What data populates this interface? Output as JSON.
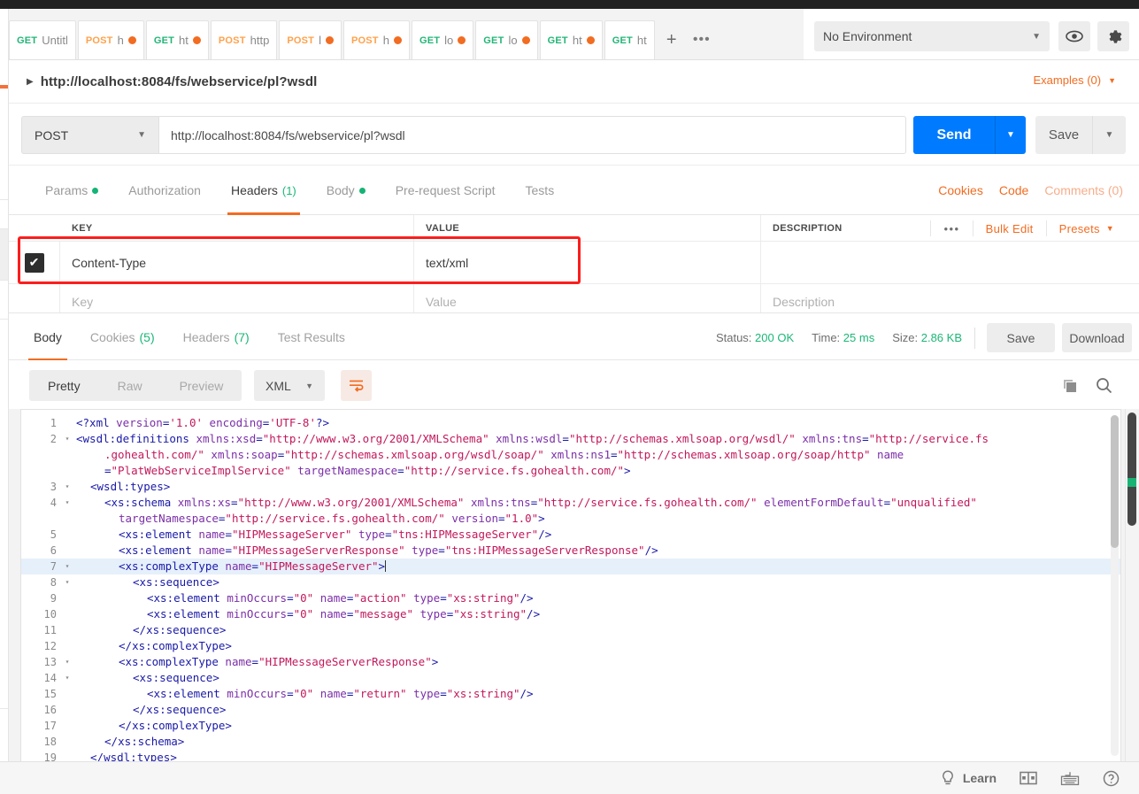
{
  "tabbar": {
    "tabs": [
      {
        "method": "GET",
        "name": "Untitl",
        "dirty": false
      },
      {
        "method": "POST",
        "name": "h",
        "dirty": true
      },
      {
        "method": "GET",
        "name": "ht",
        "dirty": true
      },
      {
        "method": "POST",
        "name": "http",
        "dirty": false
      },
      {
        "method": "POST",
        "name": "l",
        "dirty": true
      },
      {
        "method": "POST",
        "name": "h",
        "dirty": true
      },
      {
        "method": "GET",
        "name": "lo",
        "dirty": true
      },
      {
        "method": "GET",
        "name": "lo",
        "dirty": true
      },
      {
        "method": "GET",
        "name": "ht",
        "dirty": true
      },
      {
        "method": "GET",
        "name": "ht",
        "dirty": false
      }
    ],
    "add_label": "+",
    "more_label": "•••"
  },
  "environment": {
    "selected": "No Environment",
    "caret": "▼",
    "eye_icon": "eye-icon",
    "gear_icon": "gear-icon"
  },
  "request": {
    "title": "http://localhost:8084/fs/webservice/pl?wsdl",
    "examples_label": "Examples (0)",
    "method": "POST",
    "url": "http://localhost:8084/fs/webservice/pl?wsdl",
    "send_label": "Send",
    "save_label": "Save",
    "tabs": [
      {
        "label": "Params",
        "dot": true,
        "count": "",
        "active": false
      },
      {
        "label": "Authorization",
        "dot": false,
        "count": "",
        "active": false
      },
      {
        "label": "Headers",
        "dot": false,
        "count": "(1)",
        "active": true
      },
      {
        "label": "Body",
        "dot": true,
        "count": "",
        "active": false
      },
      {
        "label": "Pre-request Script",
        "dot": false,
        "count": "",
        "active": false
      },
      {
        "label": "Tests",
        "dot": false,
        "count": "",
        "active": false
      }
    ],
    "right_links": [
      {
        "label": "Cookies",
        "muted": false
      },
      {
        "label": "Code",
        "muted": false
      },
      {
        "label": "Comments (0)",
        "muted": true
      }
    ]
  },
  "headers_table": {
    "columns": {
      "key": "KEY",
      "value": "VALUE",
      "description": "DESCRIPTION"
    },
    "actions": {
      "dots": "•••",
      "bulk_edit": "Bulk Edit",
      "presets": "Presets",
      "presets_caret": "▼"
    },
    "rows": [
      {
        "checked": true,
        "key": "Content-Type",
        "value": "text/xml",
        "description": ""
      }
    ],
    "placeholder_row": {
      "key": "Key",
      "value": "Value",
      "description": "Description"
    },
    "highlight_color": "#fc1d1d"
  },
  "response": {
    "tabs": [
      {
        "label": "Body",
        "count": "",
        "active": true
      },
      {
        "label": "Cookies",
        "count": "(5)",
        "active": false
      },
      {
        "label": "Headers",
        "count": "(7)",
        "active": false
      },
      {
        "label": "Test Results",
        "count": "",
        "active": false
      }
    ],
    "status_label": "Status:",
    "status_value": "200 OK",
    "time_label": "Time:",
    "time_value": "25 ms",
    "size_label": "Size:",
    "size_value": "2.86 KB",
    "save_label": "Save",
    "download_label": "Download",
    "view_modes": [
      {
        "label": "Pretty",
        "active": true
      },
      {
        "label": "Raw",
        "active": false
      },
      {
        "label": "Preview",
        "active": false
      }
    ],
    "format": "XML",
    "format_caret": "▼",
    "wrap_icon": "word-wrap-icon",
    "copy_icon": "copy-icon",
    "search_icon": "search-icon"
  },
  "code": {
    "lines": [
      {
        "n": "1",
        "fold": "",
        "hl": false,
        "indent": 0,
        "parts": [
          {
            "t": "pun",
            "v": "<?xml "
          },
          {
            "t": "at",
            "v": "version"
          },
          {
            "t": "pun",
            "v": "="
          },
          {
            "t": "st",
            "v": "'1.0'"
          },
          {
            "t": "pun",
            "v": " "
          },
          {
            "t": "at",
            "v": "encoding"
          },
          {
            "t": "pun",
            "v": "="
          },
          {
            "t": "st",
            "v": "'UTF-8'"
          },
          {
            "t": "pun",
            "v": "?>"
          }
        ]
      },
      {
        "n": "2",
        "fold": "▾",
        "hl": false,
        "indent": 0,
        "parts": [
          {
            "t": "pun",
            "v": "<"
          },
          {
            "t": "tg",
            "v": "wsdl:definitions"
          },
          {
            "t": "pun",
            "v": " "
          },
          {
            "t": "at",
            "v": "xmlns:xsd"
          },
          {
            "t": "pun",
            "v": "="
          },
          {
            "t": "st",
            "v": "\"http://www.w3.org/2001/XMLSchema\""
          },
          {
            "t": "pun",
            "v": " "
          },
          {
            "t": "at",
            "v": "xmlns:wsdl"
          },
          {
            "t": "pun",
            "v": "="
          },
          {
            "t": "st",
            "v": "\"http://schemas.xmlsoap.org/wsdl/\""
          },
          {
            "t": "pun",
            "v": " "
          },
          {
            "t": "at",
            "v": "xmlns:tns"
          },
          {
            "t": "pun",
            "v": "="
          },
          {
            "t": "st",
            "v": "\"http://service.fs"
          }
        ]
      },
      {
        "n": "",
        "fold": "",
        "hl": false,
        "indent": 4,
        "parts": [
          {
            "t": "st",
            "v": ".gohealth.com/\""
          },
          {
            "t": "pun",
            "v": " "
          },
          {
            "t": "at",
            "v": "xmlns:soap"
          },
          {
            "t": "pun",
            "v": "="
          },
          {
            "t": "st",
            "v": "\"http://schemas.xmlsoap.org/wsdl/soap/\""
          },
          {
            "t": "pun",
            "v": " "
          },
          {
            "t": "at",
            "v": "xmlns:ns1"
          },
          {
            "t": "pun",
            "v": "="
          },
          {
            "t": "st",
            "v": "\"http://schemas.xmlsoap.org/soap/http\""
          },
          {
            "t": "pun",
            "v": " "
          },
          {
            "t": "at",
            "v": "name"
          }
        ]
      },
      {
        "n": "",
        "fold": "",
        "hl": false,
        "indent": 4,
        "parts": [
          {
            "t": "pun",
            "v": "="
          },
          {
            "t": "st",
            "v": "\"PlatWebServiceImplService\""
          },
          {
            "t": "pun",
            "v": " "
          },
          {
            "t": "at",
            "v": "targetNamespace"
          },
          {
            "t": "pun",
            "v": "="
          },
          {
            "t": "st",
            "v": "\"http://service.fs.gohealth.com/\""
          },
          {
            "t": "pun",
            "v": ">"
          }
        ]
      },
      {
        "n": "3",
        "fold": "▾",
        "hl": false,
        "indent": 2,
        "parts": [
          {
            "t": "pun",
            "v": "<"
          },
          {
            "t": "tg",
            "v": "wsdl:types"
          },
          {
            "t": "pun",
            "v": ">"
          }
        ]
      },
      {
        "n": "4",
        "fold": "▾",
        "hl": false,
        "indent": 4,
        "parts": [
          {
            "t": "pun",
            "v": "<"
          },
          {
            "t": "tg",
            "v": "xs:schema"
          },
          {
            "t": "pun",
            "v": " "
          },
          {
            "t": "at",
            "v": "xmlns:xs"
          },
          {
            "t": "pun",
            "v": "="
          },
          {
            "t": "st",
            "v": "\"http://www.w3.org/2001/XMLSchema\""
          },
          {
            "t": "pun",
            "v": " "
          },
          {
            "t": "at",
            "v": "xmlns:tns"
          },
          {
            "t": "pun",
            "v": "="
          },
          {
            "t": "st",
            "v": "\"http://service.fs.gohealth.com/\""
          },
          {
            "t": "pun",
            "v": " "
          },
          {
            "t": "at",
            "v": "elementFormDefault"
          },
          {
            "t": "pun",
            "v": "="
          },
          {
            "t": "st",
            "v": "\"unqualified\""
          }
        ]
      },
      {
        "n": "",
        "fold": "",
        "hl": false,
        "indent": 6,
        "parts": [
          {
            "t": "at",
            "v": "targetNamespace"
          },
          {
            "t": "pun",
            "v": "="
          },
          {
            "t": "st",
            "v": "\"http://service.fs.gohealth.com/\""
          },
          {
            "t": "pun",
            "v": " "
          },
          {
            "t": "at",
            "v": "version"
          },
          {
            "t": "pun",
            "v": "="
          },
          {
            "t": "st",
            "v": "\"1.0\""
          },
          {
            "t": "pun",
            "v": ">"
          }
        ]
      },
      {
        "n": "5",
        "fold": "",
        "hl": false,
        "indent": 6,
        "parts": [
          {
            "t": "pun",
            "v": "<"
          },
          {
            "t": "tg",
            "v": "xs:element"
          },
          {
            "t": "pun",
            "v": " "
          },
          {
            "t": "at",
            "v": "name"
          },
          {
            "t": "pun",
            "v": "="
          },
          {
            "t": "st",
            "v": "\"HIPMessageServer\""
          },
          {
            "t": "pun",
            "v": " "
          },
          {
            "t": "at",
            "v": "type"
          },
          {
            "t": "pun",
            "v": "="
          },
          {
            "t": "st",
            "v": "\"tns:HIPMessageServer\""
          },
          {
            "t": "pun",
            "v": "/>"
          }
        ]
      },
      {
        "n": "6",
        "fold": "",
        "hl": false,
        "indent": 6,
        "parts": [
          {
            "t": "pun",
            "v": "<"
          },
          {
            "t": "tg",
            "v": "xs:element"
          },
          {
            "t": "pun",
            "v": " "
          },
          {
            "t": "at",
            "v": "name"
          },
          {
            "t": "pun",
            "v": "="
          },
          {
            "t": "st",
            "v": "\"HIPMessageServerResponse\""
          },
          {
            "t": "pun",
            "v": " "
          },
          {
            "t": "at",
            "v": "type"
          },
          {
            "t": "pun",
            "v": "="
          },
          {
            "t": "st",
            "v": "\"tns:HIPMessageServerResponse\""
          },
          {
            "t": "pun",
            "v": "/>"
          }
        ]
      },
      {
        "n": "7",
        "fold": "▾",
        "hl": true,
        "indent": 6,
        "parts": [
          {
            "t": "pun",
            "v": "<"
          },
          {
            "t": "tg",
            "v": "xs:complexType"
          },
          {
            "t": "pun",
            "v": " "
          },
          {
            "t": "at",
            "v": "name"
          },
          {
            "t": "pun",
            "v": "="
          },
          {
            "t": "st",
            "v": "\"HIPMessageServer\""
          },
          {
            "t": "pun",
            "v": ">"
          },
          {
            "t": "cursor",
            "v": ""
          }
        ]
      },
      {
        "n": "8",
        "fold": "▾",
        "hl": false,
        "indent": 8,
        "parts": [
          {
            "t": "pun",
            "v": "<"
          },
          {
            "t": "tg",
            "v": "xs:sequence"
          },
          {
            "t": "pun",
            "v": ">"
          }
        ]
      },
      {
        "n": "9",
        "fold": "",
        "hl": false,
        "indent": 10,
        "parts": [
          {
            "t": "pun",
            "v": "<"
          },
          {
            "t": "tg",
            "v": "xs:element"
          },
          {
            "t": "pun",
            "v": " "
          },
          {
            "t": "at",
            "v": "minOccurs"
          },
          {
            "t": "pun",
            "v": "="
          },
          {
            "t": "st",
            "v": "\"0\""
          },
          {
            "t": "pun",
            "v": " "
          },
          {
            "t": "at",
            "v": "name"
          },
          {
            "t": "pun",
            "v": "="
          },
          {
            "t": "st",
            "v": "\"action\""
          },
          {
            "t": "pun",
            "v": " "
          },
          {
            "t": "at",
            "v": "type"
          },
          {
            "t": "pun",
            "v": "="
          },
          {
            "t": "st",
            "v": "\"xs:string\""
          },
          {
            "t": "pun",
            "v": "/>"
          }
        ]
      },
      {
        "n": "10",
        "fold": "",
        "hl": false,
        "indent": 10,
        "parts": [
          {
            "t": "pun",
            "v": "<"
          },
          {
            "t": "tg",
            "v": "xs:element"
          },
          {
            "t": "pun",
            "v": " "
          },
          {
            "t": "at",
            "v": "minOccurs"
          },
          {
            "t": "pun",
            "v": "="
          },
          {
            "t": "st",
            "v": "\"0\""
          },
          {
            "t": "pun",
            "v": " "
          },
          {
            "t": "at",
            "v": "name"
          },
          {
            "t": "pun",
            "v": "="
          },
          {
            "t": "st",
            "v": "\"message\""
          },
          {
            "t": "pun",
            "v": " "
          },
          {
            "t": "at",
            "v": "type"
          },
          {
            "t": "pun",
            "v": "="
          },
          {
            "t": "st",
            "v": "\"xs:string\""
          },
          {
            "t": "pun",
            "v": "/>"
          }
        ]
      },
      {
        "n": "11",
        "fold": "",
        "hl": false,
        "indent": 8,
        "parts": [
          {
            "t": "pun",
            "v": "</"
          },
          {
            "t": "tg",
            "v": "xs:sequence"
          },
          {
            "t": "pun",
            "v": ">"
          }
        ]
      },
      {
        "n": "12",
        "fold": "",
        "hl": false,
        "indent": 6,
        "parts": [
          {
            "t": "pun",
            "v": "</"
          },
          {
            "t": "tg",
            "v": "xs:complexType"
          },
          {
            "t": "pun",
            "v": ">"
          }
        ]
      },
      {
        "n": "13",
        "fold": "▾",
        "hl": false,
        "indent": 6,
        "parts": [
          {
            "t": "pun",
            "v": "<"
          },
          {
            "t": "tg",
            "v": "xs:complexType"
          },
          {
            "t": "pun",
            "v": " "
          },
          {
            "t": "at",
            "v": "name"
          },
          {
            "t": "pun",
            "v": "="
          },
          {
            "t": "st",
            "v": "\"HIPMessageServerResponse\""
          },
          {
            "t": "pun",
            "v": ">"
          }
        ]
      },
      {
        "n": "14",
        "fold": "▾",
        "hl": false,
        "indent": 8,
        "parts": [
          {
            "t": "pun",
            "v": "<"
          },
          {
            "t": "tg",
            "v": "xs:sequence"
          },
          {
            "t": "pun",
            "v": ">"
          }
        ]
      },
      {
        "n": "15",
        "fold": "",
        "hl": false,
        "indent": 10,
        "parts": [
          {
            "t": "pun",
            "v": "<"
          },
          {
            "t": "tg",
            "v": "xs:element"
          },
          {
            "t": "pun",
            "v": " "
          },
          {
            "t": "at",
            "v": "minOccurs"
          },
          {
            "t": "pun",
            "v": "="
          },
          {
            "t": "st",
            "v": "\"0\""
          },
          {
            "t": "pun",
            "v": " "
          },
          {
            "t": "at",
            "v": "name"
          },
          {
            "t": "pun",
            "v": "="
          },
          {
            "t": "st",
            "v": "\"return\""
          },
          {
            "t": "pun",
            "v": " "
          },
          {
            "t": "at",
            "v": "type"
          },
          {
            "t": "pun",
            "v": "="
          },
          {
            "t": "st",
            "v": "\"xs:string\""
          },
          {
            "t": "pun",
            "v": "/>"
          }
        ]
      },
      {
        "n": "16",
        "fold": "",
        "hl": false,
        "indent": 8,
        "parts": [
          {
            "t": "pun",
            "v": "</"
          },
          {
            "t": "tg",
            "v": "xs:sequence"
          },
          {
            "t": "pun",
            "v": ">"
          }
        ]
      },
      {
        "n": "17",
        "fold": "",
        "hl": false,
        "indent": 6,
        "parts": [
          {
            "t": "pun",
            "v": "</"
          },
          {
            "t": "tg",
            "v": "xs:complexType"
          },
          {
            "t": "pun",
            "v": ">"
          }
        ]
      },
      {
        "n": "18",
        "fold": "",
        "hl": false,
        "indent": 4,
        "parts": [
          {
            "t": "pun",
            "v": "</"
          },
          {
            "t": "tg",
            "v": "xs:schema"
          },
          {
            "t": "pun",
            "v": ">"
          }
        ]
      },
      {
        "n": "19",
        "fold": "",
        "hl": false,
        "indent": 2,
        "parts": [
          {
            "t": "pun",
            "v": "</"
          },
          {
            "t": "tg",
            "v": "wsdl:types"
          },
          {
            "t": "pun",
            "v": ">"
          }
        ]
      }
    ]
  },
  "statusbar": {
    "learn_label": "Learn",
    "learn_icon": "bulb-icon",
    "layout_icon": "two-pane-icon",
    "keyboard_icon": "keyboard-icon",
    "help_icon": "help-icon"
  }
}
